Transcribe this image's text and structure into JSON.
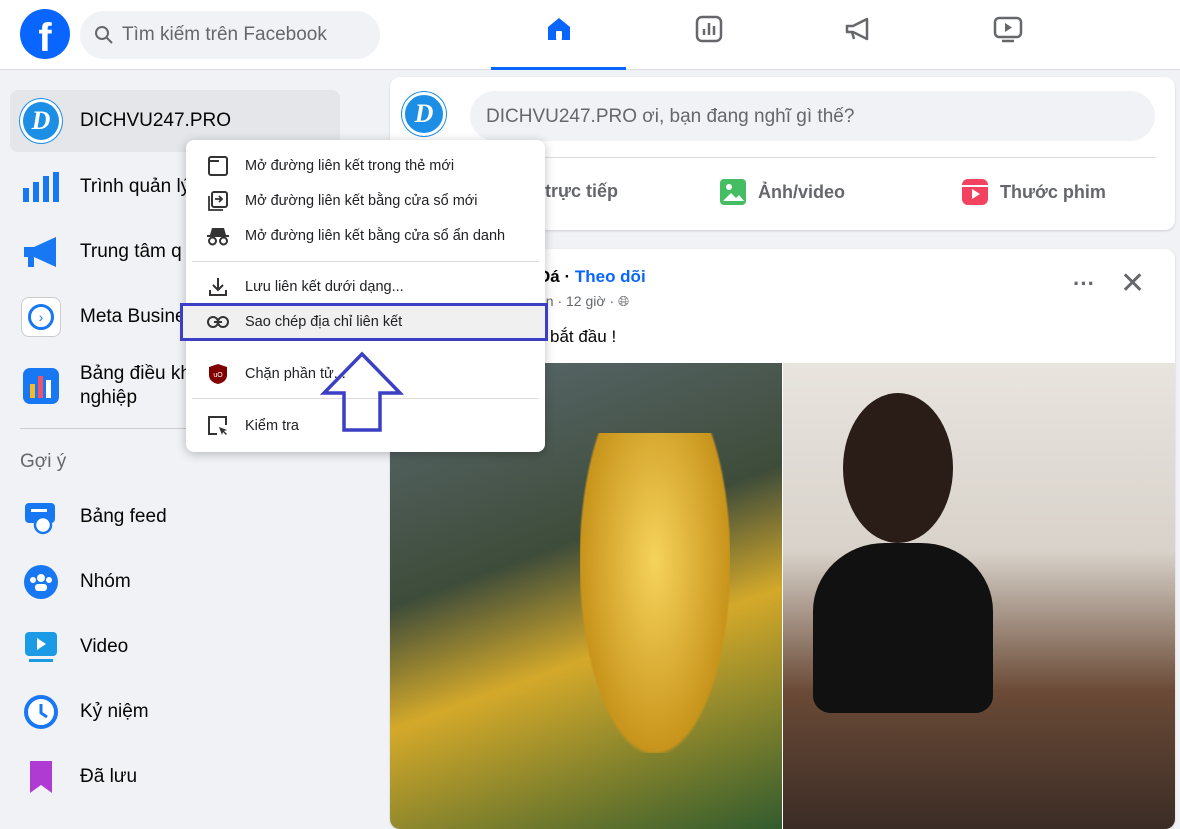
{
  "header": {
    "logo": "f",
    "search_placeholder": "Tìm kiếm trên Facebook",
    "nav": [
      "home-icon",
      "dashboard-icon",
      "megaphone-icon",
      "video-icon"
    ]
  },
  "sidebar": {
    "profile": "DICHVU247.PRO",
    "items": [
      "Trình quản lý",
      "Trung tâm q",
      "Meta Busine",
      "Bảng điều kh",
      "nghiệp"
    ],
    "section": "Gợi ý",
    "suggestions": [
      "Bảng feed",
      "Nhóm",
      "Video",
      "Kỷ niệm",
      "Đã lưu"
    ]
  },
  "composer": {
    "placeholder": "DICHVU247.PRO ơi, bạn đang nghĩ gì thế?",
    "live": "trực tiếp",
    "photo": "Ảnh/video",
    "reels": "Thước phim"
  },
  "post": {
    "author_tail": "Đá",
    "follow": "Theo dõi",
    "meta": "ạn · 12 giờ ·",
    "text": "bắt đầu !"
  },
  "context_menu": {
    "items": [
      "Mở đường liên kết trong thẻ mới",
      "Mở đường liên kết bằng cửa sổ mới",
      "Mở đường liên kết bằng cửa sổ ẩn danh",
      "Lưu liên kết dưới dạng...",
      "Sao chép địa chỉ liên kết",
      "Chặn phần tử...",
      "Kiểm tra"
    ]
  },
  "colors": {
    "brand": "#0866ff",
    "highlight": "#3b3fc4"
  }
}
